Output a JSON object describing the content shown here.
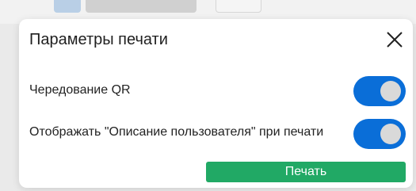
{
  "colors": {
    "toggle_on": "#0A6ED8",
    "print_button": "#21A965"
  },
  "dialog": {
    "title": "Параметры печати",
    "close_icon": "close-icon",
    "options": [
      {
        "label": "Чередование QR",
        "enabled": true
      },
      {
        "label": "Отображать \"Описание пользователя\" при печати",
        "enabled": true
      }
    ],
    "print_label": "Печать"
  }
}
